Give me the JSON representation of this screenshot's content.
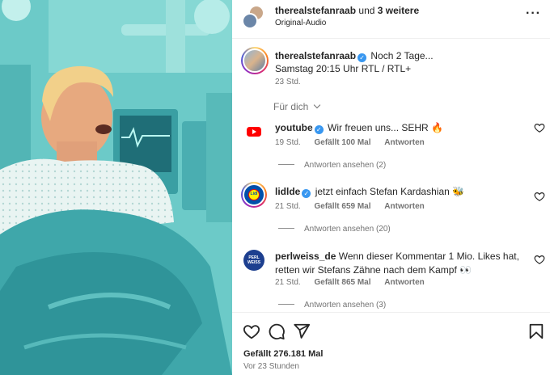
{
  "post_header": {
    "account": "therealstefanraab",
    "connector": "und",
    "others": "3 weitere",
    "audio": "Original-Audio",
    "more_icon": "more-horizontal-icon"
  },
  "caption": {
    "username": "therealstefanraab",
    "text_line1": "Noch 2 Tage...",
    "text_line2": "Samstag 20:15 Uhr RTL / RTL+",
    "time": "23 Std."
  },
  "filter": {
    "label": "Für dich"
  },
  "comments": [
    {
      "username": "youtube",
      "text": "Wir freuen uns... SEHR 🔥",
      "time": "19 Std.",
      "likes": "Gefällt 100 Mal",
      "reply": "Antworten",
      "view_replies": "Antworten ansehen (2)"
    },
    {
      "username": "lidlde",
      "text": "jetzt einfach Stefan Kardashian 🐝",
      "time": "21 Std.",
      "likes": "Gefällt 659 Mal",
      "reply": "Antworten",
      "view_replies": "Antworten ansehen (20)"
    },
    {
      "username": "perlweiss_de",
      "text": "Wenn dieser Kommentar 1 Mio. Likes hat, retten wir Stefans Zähne nach dem Kampf 👀",
      "time": "21 Std.",
      "likes": "Gefällt 865 Mal",
      "reply": "Antworten",
      "view_replies": "Antworten ansehen (3)",
      "avatar_text": "PERL WEISS"
    }
  ],
  "footer": {
    "likes": "Gefällt 276.181 Mal",
    "ago": "Vor 23 Stunden"
  },
  "colors": {
    "verified": "#3897f0",
    "muted": "#737373",
    "text": "#262626",
    "youtube_red": "#ff0000",
    "lidl_blue": "#0050aa",
    "lidl_yellow": "#fff000",
    "perlweiss_blue": "#1d3f8f"
  }
}
